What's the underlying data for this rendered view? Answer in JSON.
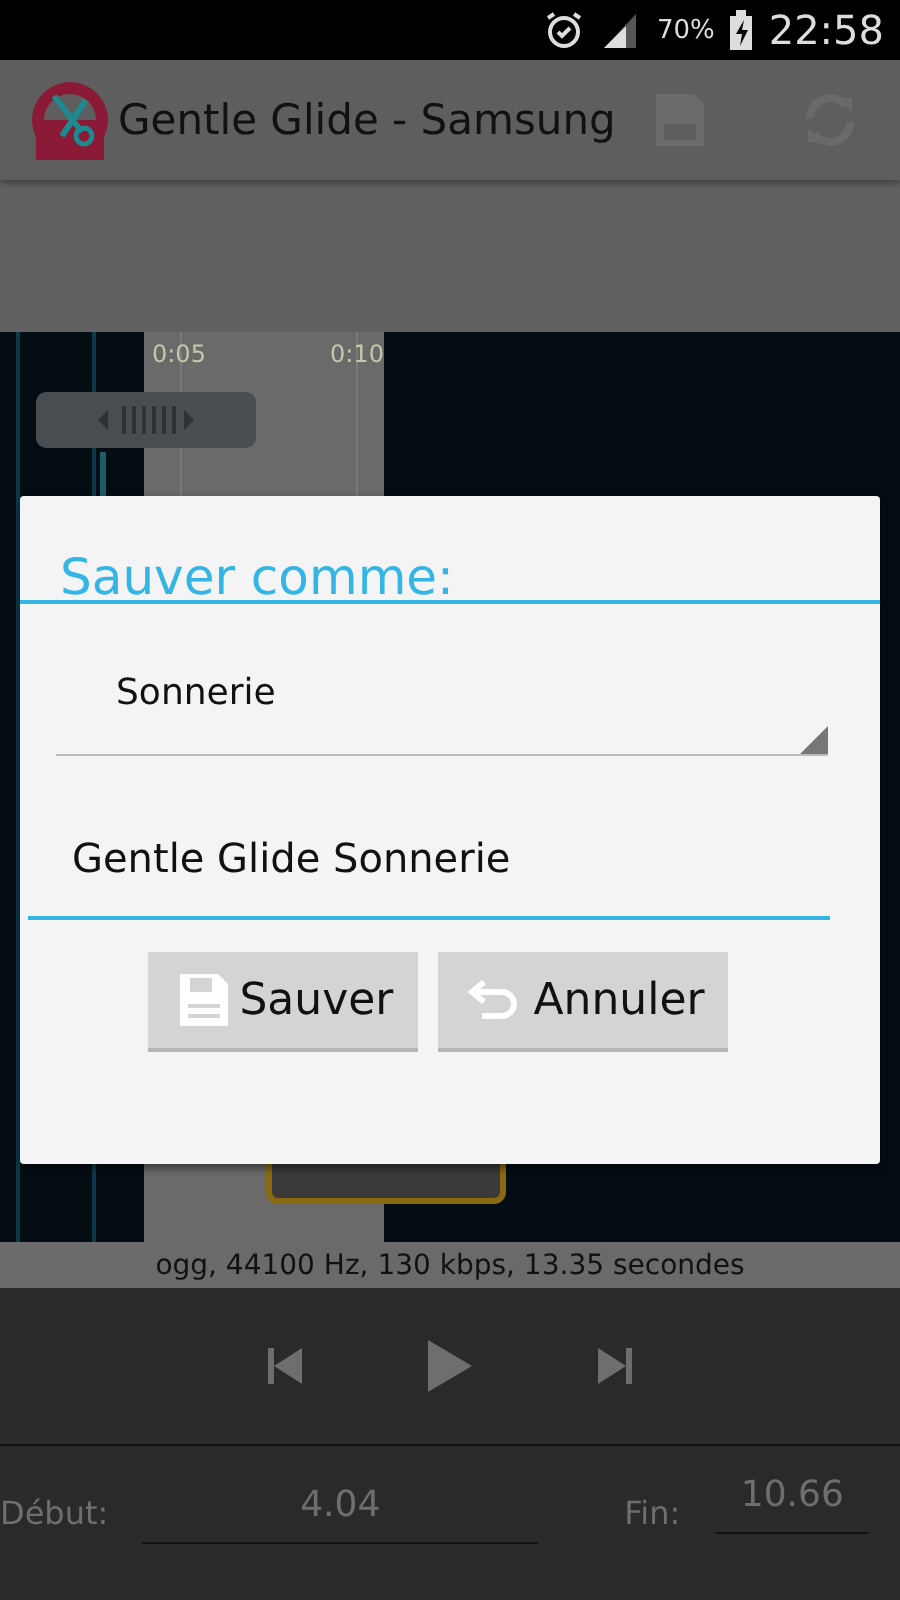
{
  "status_bar": {
    "battery": "70%",
    "time": "22:58"
  },
  "app_bar": {
    "title": "Gentle Glide - Samsung"
  },
  "timeline": {
    "ticks": [
      "0:05",
      "0:10"
    ]
  },
  "dialog": {
    "title": "Sauver comme:",
    "type_dropdown": {
      "value": "Sonnerie"
    },
    "name_field": {
      "value": "Gentle Glide Sonnerie"
    },
    "buttons": [
      {
        "label": "Sauver",
        "kind": "save"
      },
      {
        "label": "Annuler",
        "kind": "undo"
      }
    ]
  },
  "info": "ogg, 44100 Hz, 130 kbps, 13.35 secondes",
  "start": {
    "label": "Début:",
    "value": "4.04"
  },
  "end": {
    "label": "Fin:",
    "value": "10.66"
  }
}
